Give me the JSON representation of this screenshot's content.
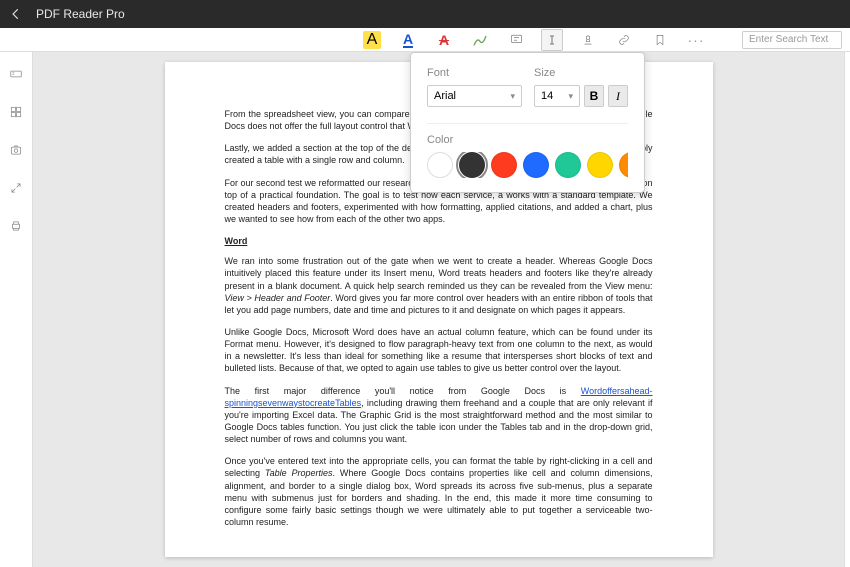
{
  "titlebar": {
    "app_name": "PDF Reader Pro"
  },
  "toolbar": {
    "search_placeholder": "Enter Search Text"
  },
  "popover": {
    "font_label": "Font",
    "size_label": "Size",
    "font_value": "Arial",
    "size_value": "14",
    "bold_label": "B",
    "italic_label": "I",
    "color_label": "Color",
    "colors": [
      "#ffffff",
      "#333333",
      "#ff3b1f",
      "#1f6bff",
      "#1ec997",
      "#ffd600",
      "#ff8c00"
    ],
    "selected_color_index": 1
  },
  "doc": {
    "p1": "From the spreadsheet view, you can compare the available options to find the best fit for the task. Google Docs does not offer the full layout control that Word does, but column options are limited.",
    "p2": "Lastly, we added a section at the top of the design for a header with the report's title. To do this we simply created a table with a single row and column.",
    "p3": "For our second test we reformatted our research paper to the MLA style. This starts a creative document on top of a practical foundation. The goal is to test how each service, a works with a standard template. We created headers and footers, experimented with how formatting, applied citations, and added a chart, plus we wanted to see how from each of the other two apps.",
    "word_heading": "Word",
    "p4a": "We ran into some frustration out of the gate when we went to create a header. Whereas Google Docs intuitively placed this feature under its Insert menu, Word treats headers and footers like they're already present in a blank document. A quick help search reminded us they can be revealed from the View menu: ",
    "p4b": "View > Header and Footer",
    "p4c": ". Word gives you far more control over headers with an entire ribbon of tools that let you add page numbers, date and time and pictures to it and designate on which pages it appears.",
    "p5": "Unlike Google Docs, Microsoft Word does have an actual column feature, which can be found under its Format menu. However, it's designed to flow paragraph-heavy text from one column to the next, as would in a newsletter. It's less than ideal for something like a resume that intersperses short blocks of text and bulleted lists. Because of that, we opted to again use tables to give us better control over the layout.",
    "p6a": "The first major difference you'll notice from Google Docs is ",
    "link1": "Wordoffersahead-spinningsevenwaystocreateTables",
    "p6b": ", including drawing them freehand and a couple that are only relevant if you're importing Excel data. The Graphic Grid is the most straightforward method and the most similar to Google Docs tables function. You just click the table icon under the Tables tab and in the drop-down grid, select number of rows and columns you want.",
    "p7a": "Once you've entered text into the appropriate cells, you can format the table by right-clicking in a cell and selecting ",
    "p7b": "Table Properties",
    "p7c": ". Where Google Docs contains properties like cell and column dimensions, alignment, and border to a single dialog box, Word spreads its across five sub-menus, plus a separate menu with submenus just for borders and shading. In the end, this made it more time consuming to configure some fairly basic settings though we were ultimately able to put together a serviceable two-column resume."
  }
}
